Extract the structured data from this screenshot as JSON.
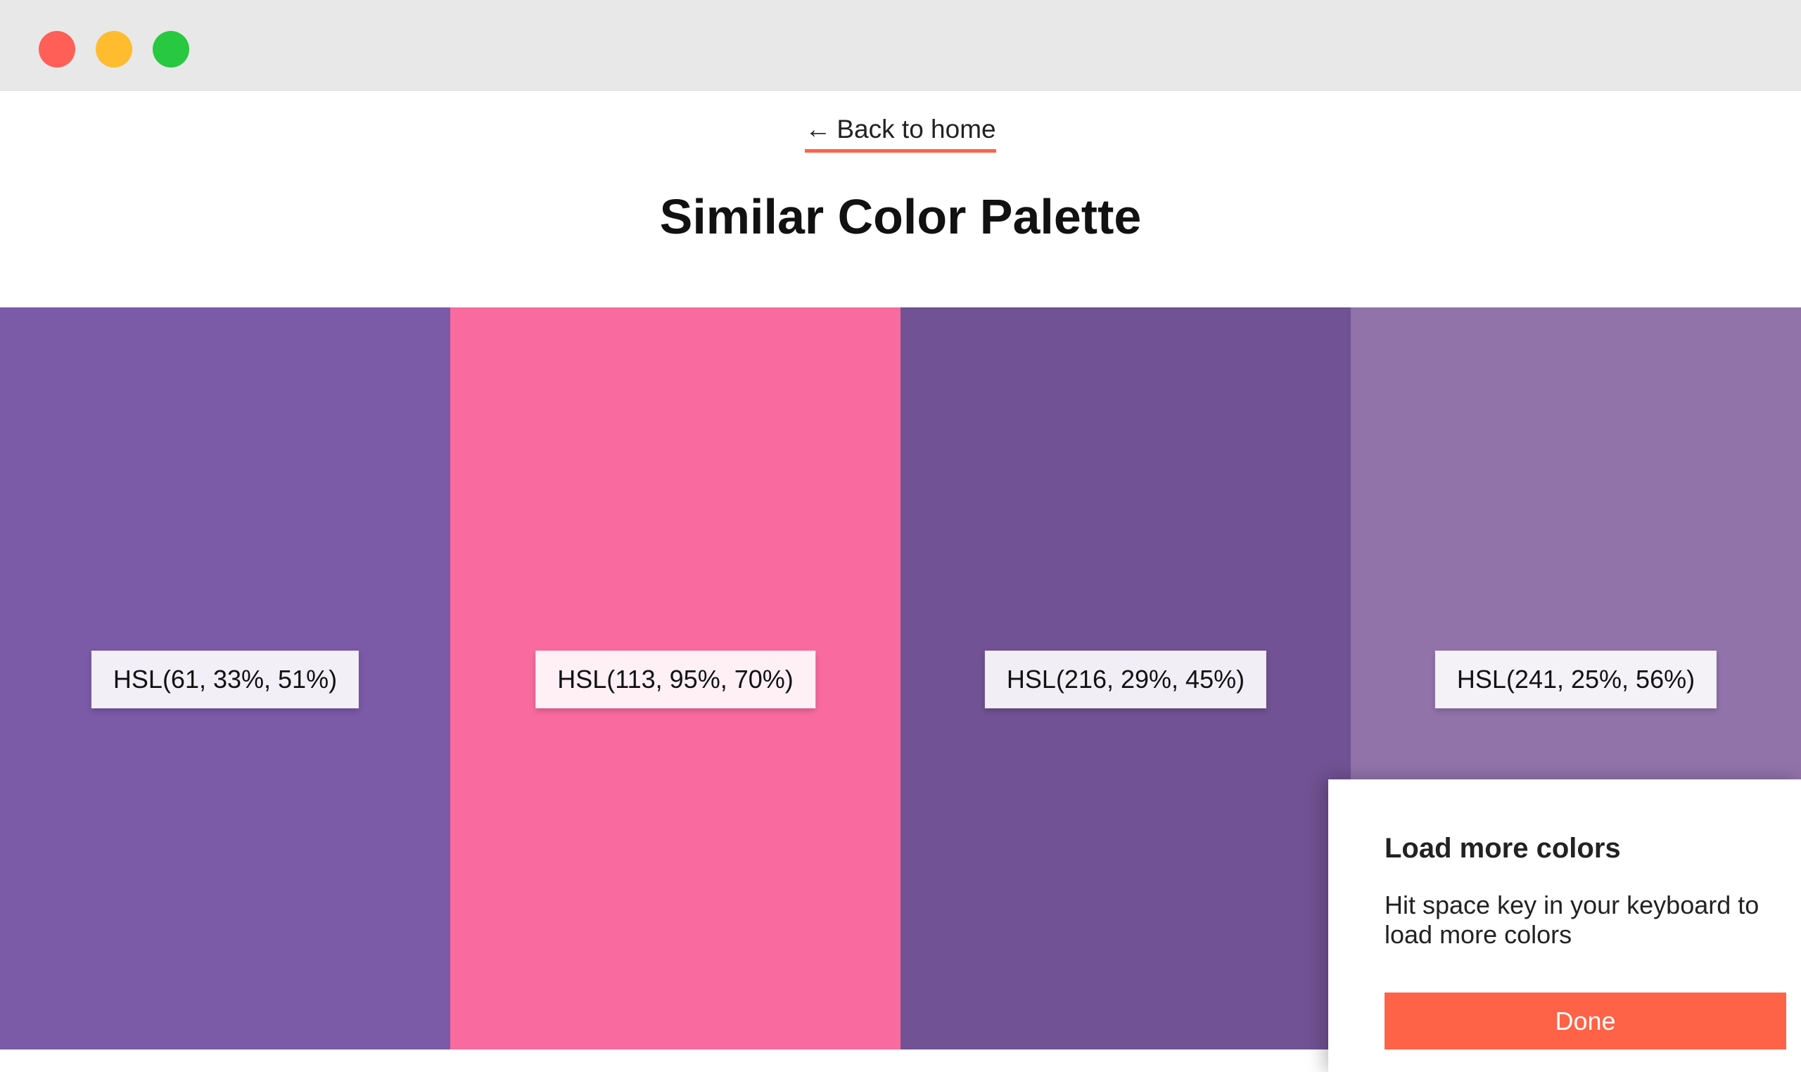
{
  "window": {
    "controls": [
      {
        "name": "close",
        "color": "#ff5f57"
      },
      {
        "name": "minimize",
        "color": "#febc2e"
      },
      {
        "name": "maximize",
        "color": "#28c840"
      }
    ]
  },
  "header": {
    "back_arrow": "←",
    "back_label": "Back to home",
    "title": "Similar Color Palette",
    "accent_color": "#ff6347"
  },
  "palette": {
    "swatches": [
      {
        "label": "HSL(61, 33%, 51%)",
        "color": "#7b5aa8"
      },
      {
        "label": "HSL(113, 95%, 70%)",
        "color": "#f96b9f"
      },
      {
        "label": "HSL(216, 29%, 45%)",
        "color": "#715294"
      },
      {
        "label": "HSL(241, 25%, 56%)",
        "color": "#9173aa"
      }
    ]
  },
  "toast": {
    "title": "Load more colors",
    "body": "Hit space key in your keyboard to load more colors",
    "button_label": "Done",
    "button_color": "#ff6347"
  }
}
